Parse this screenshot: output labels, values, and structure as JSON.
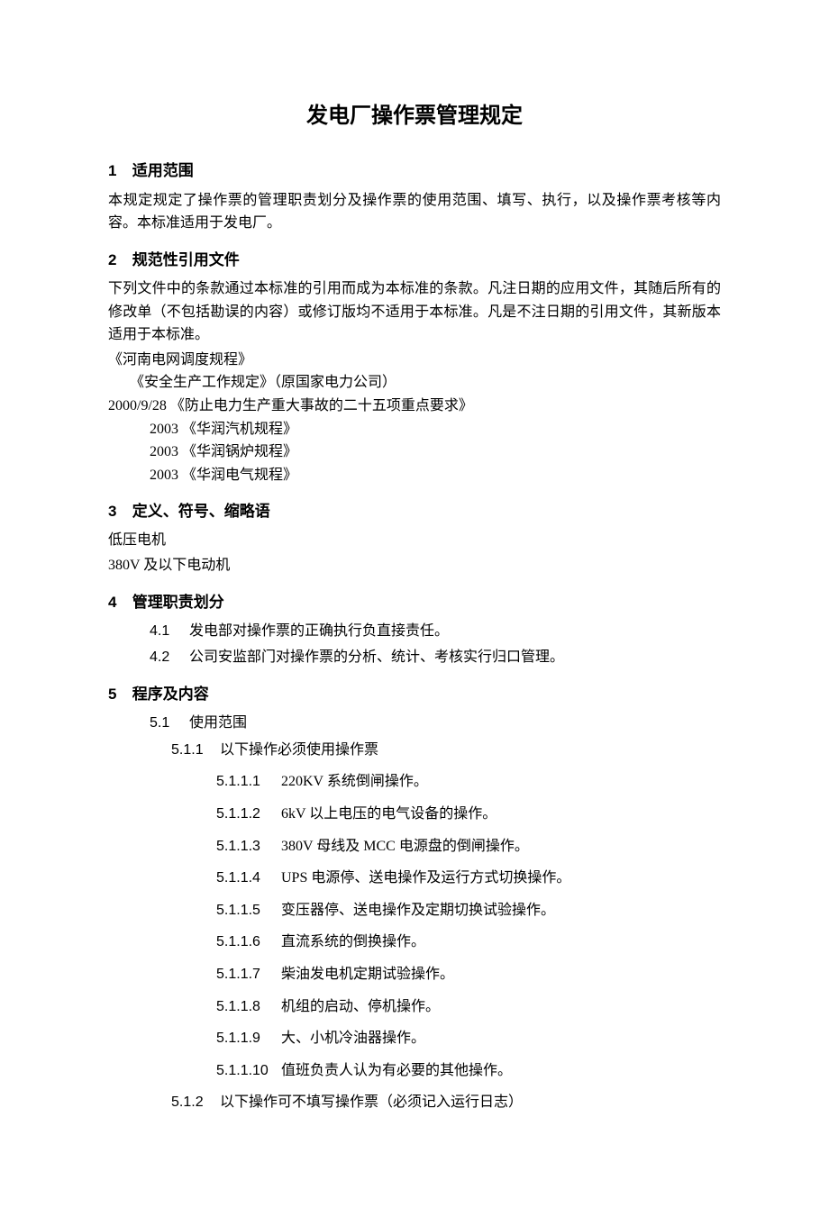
{
  "title": "发电厂操作票管理规定",
  "s1": {
    "num": "1",
    "heading": "适用范围",
    "p1": "本规定规定了操作票的管理职责划分及操作票的使用范围、填写、执行，以及操作票考核等内容。本标准适用于发电厂。"
  },
  "s2": {
    "num": "2",
    "heading": "规范性引用文件",
    "p1": "下列文件中的条款通过本标准的引用而成为本标准的条款。凡注日期的应用文件，其随后所有的修改单（不包括勘误的内容）或修订版均不适用于本标准。凡是不注日期的引用文件，其新版本适用于本标准。",
    "refs": {
      "r1": "《河南电网调度规程》",
      "r2": "《安全生产工作规定》（原国家电力公司）",
      "r3": "2000/9/28 《防止电力生产重大事故的二十五项重点要求》",
      "r4": "2003 《华润汽机规程》",
      "r5": "2003 《华润锅炉规程》",
      "r6": "2003 《华润电气规程》"
    }
  },
  "s3": {
    "num": "3",
    "heading": "定义、符号、缩略语",
    "p1": "低压电机",
    "p2": "380V 及以下电动机"
  },
  "s4": {
    "num": "4",
    "heading": "管理职责划分",
    "i1": {
      "num": "4.1",
      "text": "发电部对操作票的正确执行负直接责任。"
    },
    "i2": {
      "num": "4.2",
      "text": "公司安监部门对操作票的分析、统计、考核实行归口管理。"
    }
  },
  "s5": {
    "num": "5",
    "heading": "程序及内容",
    "i1": {
      "num": "5.1",
      "text": "使用范围"
    },
    "i11": {
      "num": "5.1.1",
      "text": "以下操作必须使用操作票"
    },
    "lvl3": {
      "a": {
        "num": "5.1.1.1",
        "text": "220KV 系统倒闸操作。"
      },
      "b": {
        "num": "5.1.1.2",
        "text": "6kV 以上电压的电气设备的操作。"
      },
      "c": {
        "num": "5.1.1.3",
        "text": "380V 母线及 MCC 电源盘的倒闸操作。"
      },
      "d": {
        "num": "5.1.1.4",
        "text": "UPS 电源停、送电操作及运行方式切换操作。"
      },
      "e": {
        "num": "5.1.1.5",
        "text": "变压器停、送电操作及定期切换试验操作。"
      },
      "f": {
        "num": "5.1.1.6",
        "text": "直流系统的倒换操作。"
      },
      "g": {
        "num": "5.1.1.7",
        "text": "柴油发电机定期试验操作。"
      },
      "h": {
        "num": "5.1.1.8",
        "text": "机组的启动、停机操作。"
      },
      "i": {
        "num": "5.1.1.9",
        "text": "大、小机冷油器操作。"
      },
      "j": {
        "num": "5.1.1.10",
        "text": "值班负责人认为有必要的其他操作。"
      }
    },
    "i12": {
      "num": "5.1.2",
      "text": "以下操作可不填写操作票（必须记入运行日志）"
    }
  }
}
